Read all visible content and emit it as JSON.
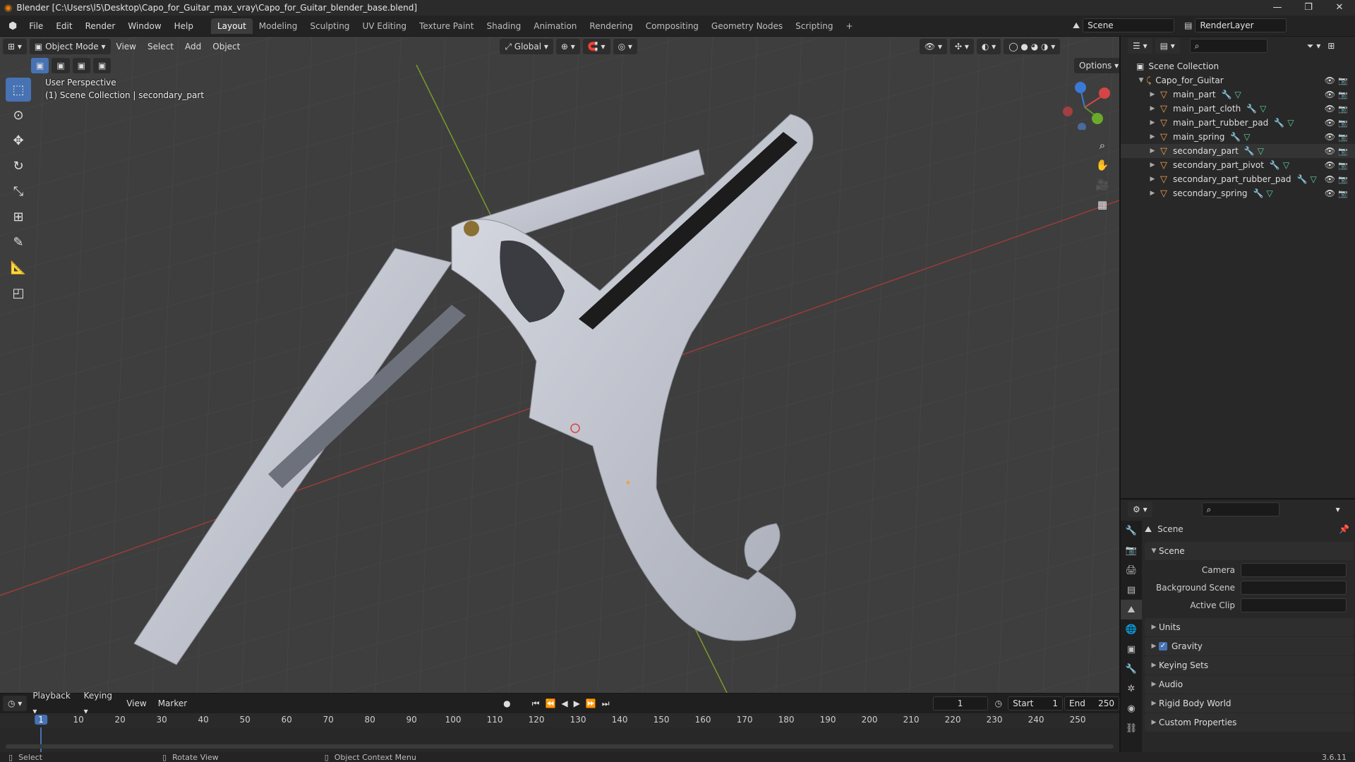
{
  "window": {
    "title": "Blender [C:\\Users\\l5\\Desktop\\Capo_for_Guitar_max_vray\\Capo_for_Guitar_blender_base.blend]",
    "controls": [
      "—",
      "❐",
      "✕"
    ]
  },
  "menu": [
    "File",
    "Edit",
    "Render",
    "Window",
    "Help"
  ],
  "workspaces": [
    "Layout",
    "Modeling",
    "Sculpting",
    "UV Editing",
    "Texture Paint",
    "Shading",
    "Animation",
    "Rendering",
    "Compositing",
    "Geometry Nodes",
    "Scripting"
  ],
  "active_workspace": "Layout",
  "scene_name": "Scene",
  "view_layer": "RenderLayer",
  "viewport": {
    "mode": "Object Mode",
    "menus": [
      "View",
      "Select",
      "Add",
      "Object"
    ],
    "orientation": "Global",
    "options_label": "Options",
    "perspective_label": "User Perspective",
    "collection_label": "(1) Scene Collection | secondary_part",
    "accent": "#4772b3"
  },
  "outliner": {
    "root": "Scene Collection",
    "collection": "Capo_for_Guitar",
    "objects": [
      "main_part",
      "main_part_cloth",
      "main_part_rubber_pad",
      "main_spring",
      "secondary_part",
      "secondary_part_pivot",
      "secondary_part_rubber_pad",
      "secondary_spring"
    ],
    "selected": "secondary_part"
  },
  "properties": {
    "header": "Scene",
    "panel_scene": "Scene",
    "camera_label": "Camera",
    "background_label": "Background Scene",
    "clip_label": "Active Clip",
    "panels": [
      "Units",
      "Gravity",
      "Keying Sets",
      "Audio",
      "Rigid Body World",
      "Custom Properties"
    ]
  },
  "timeline": {
    "menus": [
      "Playback",
      "Keying",
      "View",
      "Marker"
    ],
    "current_frame": "1",
    "start_label": "Start",
    "start": "1",
    "end_label": "End",
    "end": "250",
    "ticks": [
      "1",
      "10",
      "20",
      "30",
      "40",
      "50",
      "60",
      "70",
      "80",
      "90",
      "100",
      "110",
      "120",
      "130",
      "140",
      "150",
      "160",
      "170",
      "180",
      "190",
      "200",
      "210",
      "220",
      "230",
      "240",
      "250"
    ]
  },
  "statusbar": {
    "select": "Select",
    "rotate": "Rotate View",
    "context": "Object Context Menu",
    "version": "3.6.11"
  }
}
